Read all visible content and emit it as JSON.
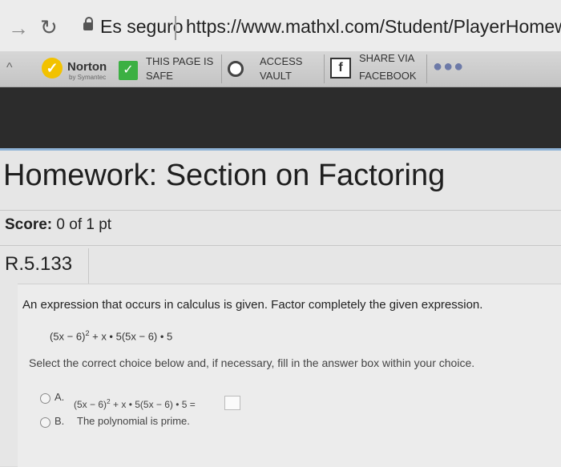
{
  "browser": {
    "secure_label": "Es seguro",
    "url": "https://www.mathxl.com/Student/PlayerHomework.aspx"
  },
  "norton_toolbar": {
    "brand": "Norton",
    "brand_sub": "by Symantec",
    "safe_line1": "THIS PAGE IS",
    "safe_line2": "SAFE",
    "vault_line1": "ACCESS",
    "vault_line2": "VAULT",
    "share_line1": "SHARE VIA",
    "share_line2": "FACEBOOK"
  },
  "page": {
    "title": "Homework: Section on Factoring",
    "score_label": "Score:",
    "score_value": "0 of 1 pt",
    "question_id": "R.5.133",
    "instruction": "An expression that occurs in calculus is given. Factor completely the given expression.",
    "expression_base": "(5x − 6)",
    "expression_exp": "2",
    "expression_rest": " + x • 5(5x − 6) • 5",
    "select_instruction": "Select the correct choice below and, if necessary, fill in the answer box within your choice.",
    "option_a_label": "A.",
    "option_a_expr_base": "(5x − 6)",
    "option_a_expr_exp": "2",
    "option_a_expr_rest": " + x • 5(5x − 6) • 5 =",
    "option_b_label": "B.",
    "option_b_text": "The polynomial is prime."
  }
}
